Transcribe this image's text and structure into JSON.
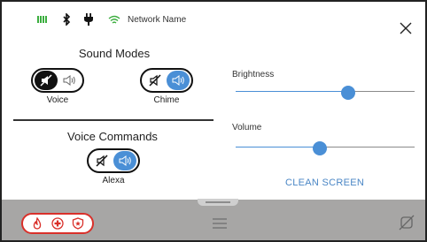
{
  "status_bar": {
    "icons": [
      "battery-icon",
      "bluetooth-icon",
      "plug-icon",
      "wifi-icon"
    ],
    "network_name": "Network Name"
  },
  "sound_modes": {
    "title": "Sound Modes",
    "voice": {
      "label": "Voice",
      "state": "muted"
    },
    "chime": {
      "label": "Chime",
      "state": "on"
    }
  },
  "voice_commands": {
    "title": "Voice Commands",
    "alexa": {
      "label": "Alexa",
      "state": "on"
    }
  },
  "brightness": {
    "label": "Brightness",
    "level": 0.63
  },
  "volume": {
    "label": "Volume",
    "level": 0.47
  },
  "clean_screen": {
    "label": "CLEAN SCREEN"
  },
  "emergency": {
    "icons": [
      "fire-icon",
      "medical-icon",
      "police-icon"
    ]
  },
  "colors": {
    "accent": "#4a8fd6",
    "emergency": "#d9302a",
    "bottom_bar": "#a7a6a5",
    "status_green": "#3cae3f"
  }
}
